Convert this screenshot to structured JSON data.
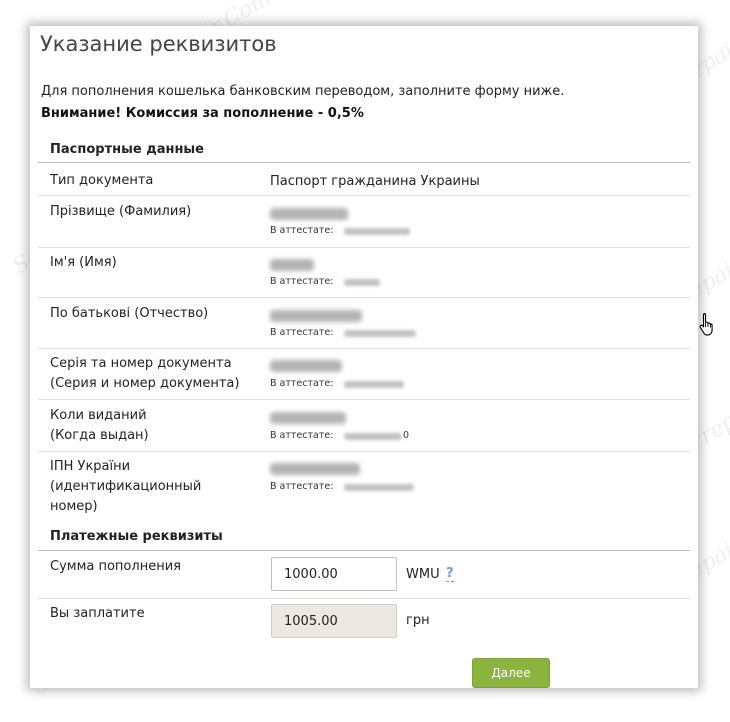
{
  "title": "Указание реквизитов",
  "intro": "Для пополнения кошелька банковским переводом, заполните форму ниже.",
  "warning": "Внимание! Комиссия за пополнение - 0,5%",
  "passport": {
    "heading": "Паспортные данные",
    "doc_type_label": "Тип документа",
    "doc_type_value": "Паспорт гражданина Украины",
    "attest_prefix": "В аттестате:",
    "surname_label": "Прізвище (Фамилия)",
    "name_label": "Ім'я (Имя)",
    "patronymic_label": "По батькові (Отчество)",
    "doc_number_label_1": "Серія та номер документа",
    "doc_number_label_2": "(Серия и номер документа)",
    "issued_label_1": "Коли виданий",
    "issued_label_2": "(Когда выдан)",
    "issued_attest_tail": "0",
    "ipn_label_1": "ІПН України",
    "ipn_label_2": "(идентификационный",
    "ipn_label_3": "номер)"
  },
  "payment": {
    "heading": "Платежные реквизиты",
    "amount_label": "Сумма пополнения",
    "amount_value": "1000.00",
    "amount_unit": "WMU",
    "help": "?",
    "pay_label": "Вы заплатите",
    "pay_value": "1005.00",
    "pay_unit": "грн"
  },
  "next_button": "Далее",
  "watermark": "Soringpcrepair.Com"
}
